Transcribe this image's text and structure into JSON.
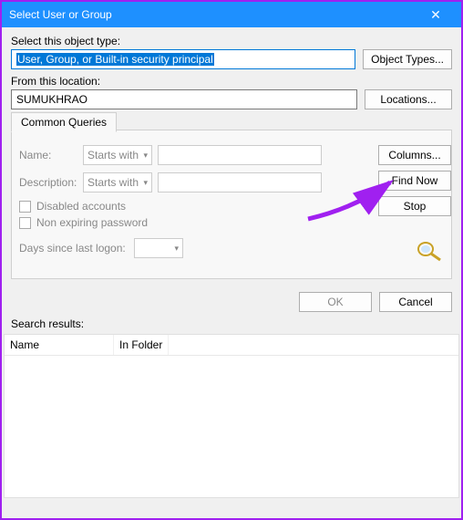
{
  "titlebar": {
    "title": "Select User or Group",
    "close": "✕"
  },
  "objectType": {
    "label": "Select this object type:",
    "value": "User, Group, or Built-in security principal",
    "button": "Object Types..."
  },
  "location": {
    "label": "From this location:",
    "value": "SUMUKHRAO",
    "button": "Locations..."
  },
  "queries": {
    "tab": "Common Queries",
    "nameLabel": "Name:",
    "nameOp": "Starts with",
    "descLabel": "Description:",
    "descOp": "Starts with",
    "disabled": "Disabled accounts",
    "nonExpiring": "Non expiring password",
    "daysSince": "Days since last logon:",
    "columnsBtn": "Columns...",
    "findBtn": "Find Now",
    "stopBtn": "Stop"
  },
  "buttons": {
    "ok": "OK",
    "cancel": "Cancel"
  },
  "results": {
    "label": "Search results:",
    "colName": "Name",
    "colFolder": "In Folder"
  }
}
